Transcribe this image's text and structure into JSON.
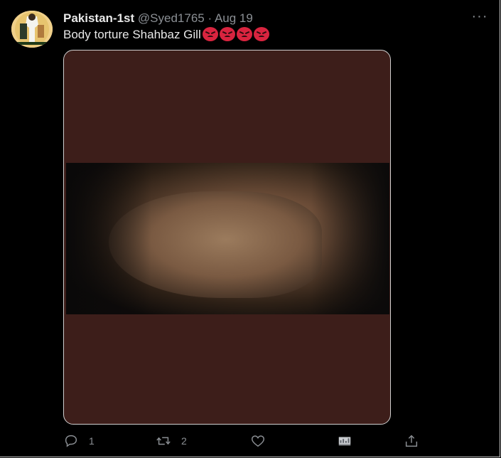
{
  "tweet": {
    "author_name": "Pakistan-1st",
    "handle": "@Syed1765",
    "separator": "·",
    "date": "Aug 19",
    "text": "Body torture Shahbaz Gill",
    "emoji_count": 4,
    "emoji_name": "angry-face"
  },
  "actions": {
    "reply_count": "1",
    "retweet_count": "2",
    "like_count": ""
  },
  "icons": {
    "more": "more-icon",
    "reply": "reply-icon",
    "retweet": "retweet-icon",
    "like": "like-icon",
    "analytics": "analytics-icon",
    "share": "share-icon"
  },
  "colors": {
    "background": "#000000",
    "text": "#e8e8e8",
    "muted": "#8b8f94",
    "media_bg": "#3d1e1a",
    "emoji": "#d9243f"
  }
}
